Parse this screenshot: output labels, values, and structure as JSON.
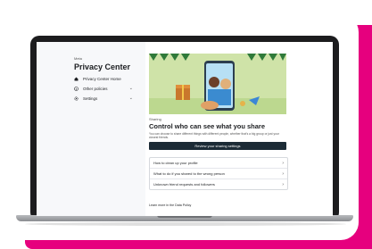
{
  "colors": {
    "accent": "#e6007e",
    "cta": "#1c2b36",
    "hero_bg": "#cfe3a8"
  },
  "sidebar": {
    "brand": "Meta",
    "title": "Privacy Center",
    "items": [
      {
        "label": "Privacy Center Home",
        "icon": "home-icon"
      },
      {
        "label": "Other policies",
        "icon": "info-icon",
        "chevron": "⌄"
      },
      {
        "label": "Settings",
        "icon": "gear-icon",
        "chevron": "⌄"
      }
    ]
  },
  "main": {
    "eyebrow": "Sharing",
    "headline": "Control who can see what you share",
    "description": "You can choose to share different things with different people, whether that's a big group or just your closest friends.",
    "cta_label": "Review your sharing settings",
    "list": [
      {
        "label": "How to clean up your profile"
      },
      {
        "label": "What to do if you shared to the wrong person"
      },
      {
        "label": "Unknown friend requests and followers"
      }
    ],
    "row_chevron": "›",
    "learn_more": "Learn more in the Data Policy"
  }
}
